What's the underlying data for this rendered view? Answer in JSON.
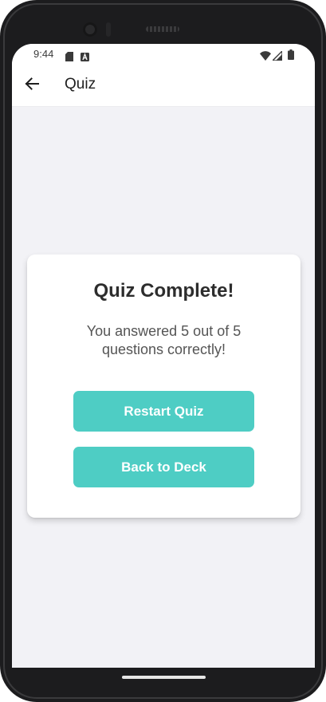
{
  "status_bar": {
    "time": "9:44",
    "icons": [
      "sd-card-icon",
      "keyboard-a-icon",
      "wifi-icon",
      "cellular-signal-icon",
      "battery-icon"
    ]
  },
  "app_bar": {
    "back_icon": "arrow-back-icon",
    "title": "Quiz"
  },
  "result_card": {
    "title": "Quiz Complete!",
    "message": "You answered 5 out of 5 questions correctly!",
    "restart_label": "Restart Quiz",
    "back_label": "Back to Deck"
  },
  "colors": {
    "accent": "#4ecdc4",
    "background": "#f2f2f6",
    "card": "#ffffff",
    "text_dark": "#2d2d2d",
    "text_muted": "#555555"
  }
}
